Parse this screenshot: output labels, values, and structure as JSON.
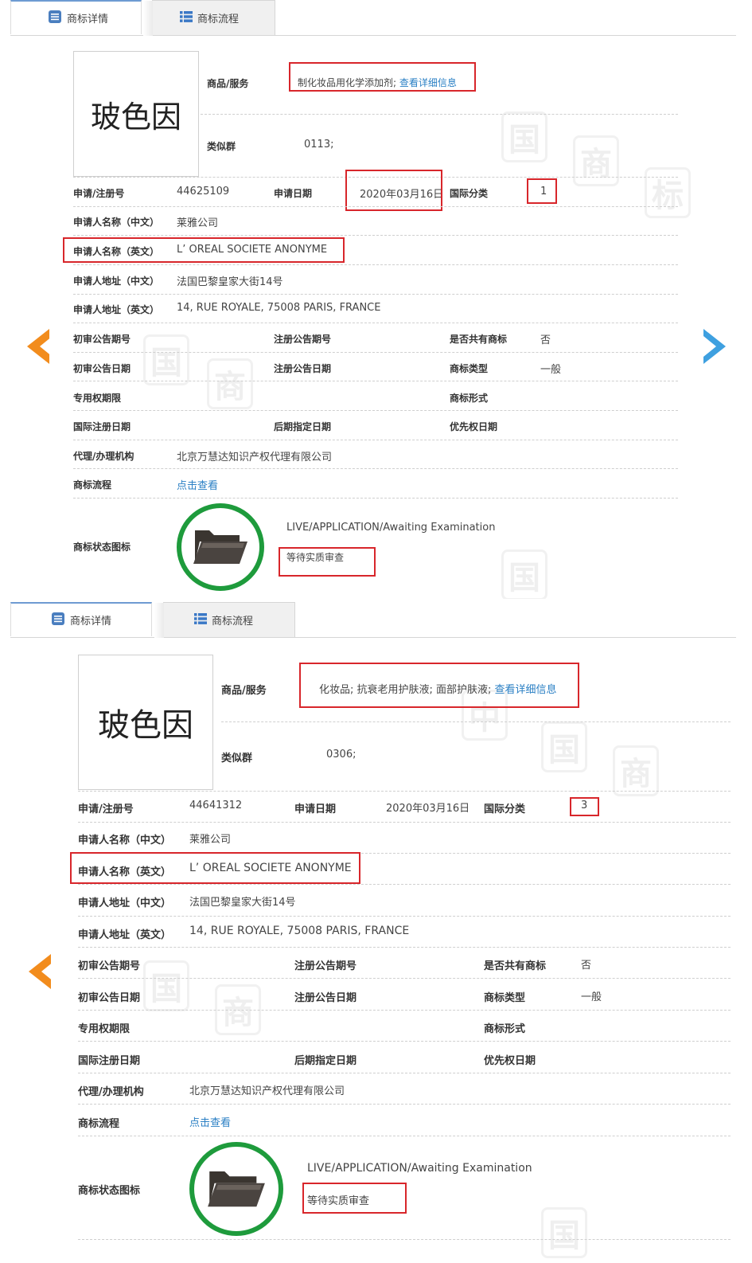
{
  "tabs": {
    "details": "商标详情",
    "flow": "商标流程"
  },
  "labels": {
    "goods": "商品/服务",
    "similar_group": "类似群",
    "reg_no": "申请/注册号",
    "app_date": "申请日期",
    "intl_class": "国际分类",
    "applicant_cn": "申请人名称（中文）",
    "applicant_en": "申请人名称（英文）",
    "address_cn": "申请人地址（中文）",
    "address_en": "申请人地址（英文）",
    "prelim_pub_no": "初审公告期号",
    "reg_pub_no": "注册公告期号",
    "shared": "是否共有商标",
    "prelim_pub_date": "初审公告日期",
    "reg_pub_date": "注册公告日期",
    "tm_type": "商标类型",
    "exclusive_period": "专用权期限",
    "tm_form": "商标形式",
    "intl_reg_date": "国际注册日期",
    "later_designation_date": "后期指定日期",
    "priority_date": "优先权日期",
    "agency": "代理/办理机构",
    "flow": "商标流程",
    "status_icon": "商标状态图标"
  },
  "colors": {
    "status_ring": "#1e9b3c",
    "highlight": "#d8262b",
    "link": "#2a7fc4",
    "nav_prev": "#f28c1d",
    "nav_next": "#3ea0e0"
  },
  "icons": {
    "details_tab": "list-doc-icon",
    "flow_tab": "list-icon",
    "status": "folder-icon"
  },
  "records": [
    {
      "trademark": "玻色因",
      "goods": "制化妆品用化学添加剂; ",
      "goods_link": "查看详细信息",
      "similar_group": "0113;",
      "reg_no": "44625109",
      "app_date": "2020年03月16日",
      "intl_class": "1",
      "applicant_cn": "莱雅公司",
      "applicant_en": "L’ OREAL SOCIETE ANONYME",
      "address_cn": "法国巴黎皇家大街14号",
      "address_en": "14, RUE ROYALE, 75008 PARIS, FRANCE",
      "shared": "否",
      "tm_type": "一般",
      "agency": "北京万慧达知识产权代理有限公司",
      "flow_link": "点击查看",
      "status_en": "LIVE/APPLICATION/Awaiting Examination",
      "status_cn": "等待实质审查"
    },
    {
      "trademark": "玻色因",
      "goods": "化妆品; 抗衰老用护肤液; 面部护肤液; ",
      "goods_link": "查看详细信息",
      "similar_group": "0306;",
      "reg_no": "44641312",
      "app_date": "2020年03月16日",
      "intl_class": "3",
      "applicant_cn": "莱雅公司",
      "applicant_en": "L’ OREAL SOCIETE ANONYME",
      "address_cn": "法国巴黎皇家大街14号",
      "address_en": "14, RUE ROYALE, 75008 PARIS, FRANCE",
      "shared": "否",
      "tm_type": "一般",
      "agency": "北京万慧达知识产权代理有限公司",
      "flow_link": "点击查看",
      "status_en": "LIVE/APPLICATION/Awaiting Examination",
      "status_cn": "等待实质审查"
    }
  ]
}
